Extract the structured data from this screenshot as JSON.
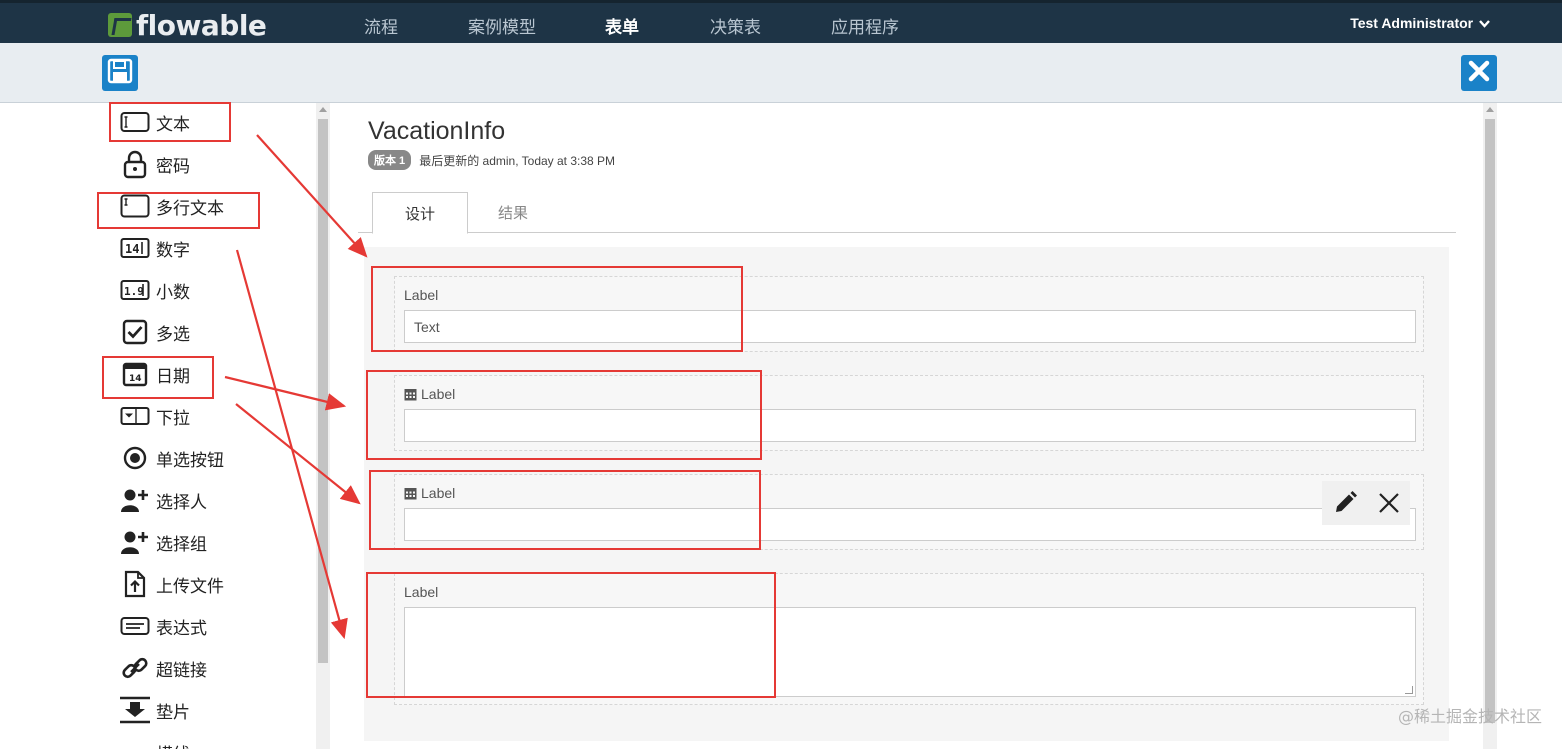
{
  "app": {
    "brand": "flowable"
  },
  "nav": {
    "items": [
      {
        "label": "流程",
        "active": false
      },
      {
        "label": "案例模型",
        "active": false
      },
      {
        "label": "表单",
        "active": true
      },
      {
        "label": "决策表",
        "active": false
      },
      {
        "label": "应用程序",
        "active": false
      }
    ],
    "user": "Test Administrator"
  },
  "toolbar": {
    "save_icon": "save-icon",
    "close_icon": "close-icon"
  },
  "palette": {
    "items": [
      {
        "label": "文本",
        "icon": "text-field-icon"
      },
      {
        "label": "密码",
        "icon": "lock-icon"
      },
      {
        "label": "多行文本",
        "icon": "multiline-text-icon"
      },
      {
        "label": "数字",
        "icon": "number-icon"
      },
      {
        "label": "小数",
        "icon": "decimal-icon"
      },
      {
        "label": "多选",
        "icon": "checkbox-icon"
      },
      {
        "label": "日期",
        "icon": "calendar-icon"
      },
      {
        "label": "下拉",
        "icon": "dropdown-icon"
      },
      {
        "label": "单选按钮",
        "icon": "radio-icon"
      },
      {
        "label": "选择人",
        "icon": "add-user-icon"
      },
      {
        "label": "选择组",
        "icon": "add-group-icon"
      },
      {
        "label": "上传文件",
        "icon": "upload-icon"
      },
      {
        "label": "表达式",
        "icon": "expression-icon"
      },
      {
        "label": "超链接",
        "icon": "link-icon"
      },
      {
        "label": "垫片",
        "icon": "spacer-icon"
      },
      {
        "label": "横线",
        "icon": "line-icon"
      }
    ]
  },
  "form": {
    "title": "VacationInfo",
    "version_badge": "版本 1",
    "last_updated": "最后更新的 admin, Today at 3:38 PM",
    "tabs": [
      {
        "label": "设计",
        "active": true
      },
      {
        "label": "结果",
        "active": false
      }
    ],
    "fields": [
      {
        "label": "Label",
        "value": "Text",
        "type": "text",
        "has_calendar_icon": false
      },
      {
        "label": "Label",
        "value": "",
        "type": "date",
        "has_calendar_icon": true
      },
      {
        "label": "Label",
        "value": "",
        "type": "date",
        "has_calendar_icon": true
      },
      {
        "label": "Label",
        "value": "",
        "type": "multiline",
        "has_calendar_icon": false
      }
    ],
    "field_actions": {
      "edit_icon": "pencil-icon",
      "remove_icon": "close-icon"
    }
  },
  "colors": {
    "nav_bg": "#1e3446",
    "accent": "#1a82c8",
    "annotation": "#e53935",
    "brand_green": "#5d9a3b"
  },
  "watermark": "@稀土掘金技术社区"
}
